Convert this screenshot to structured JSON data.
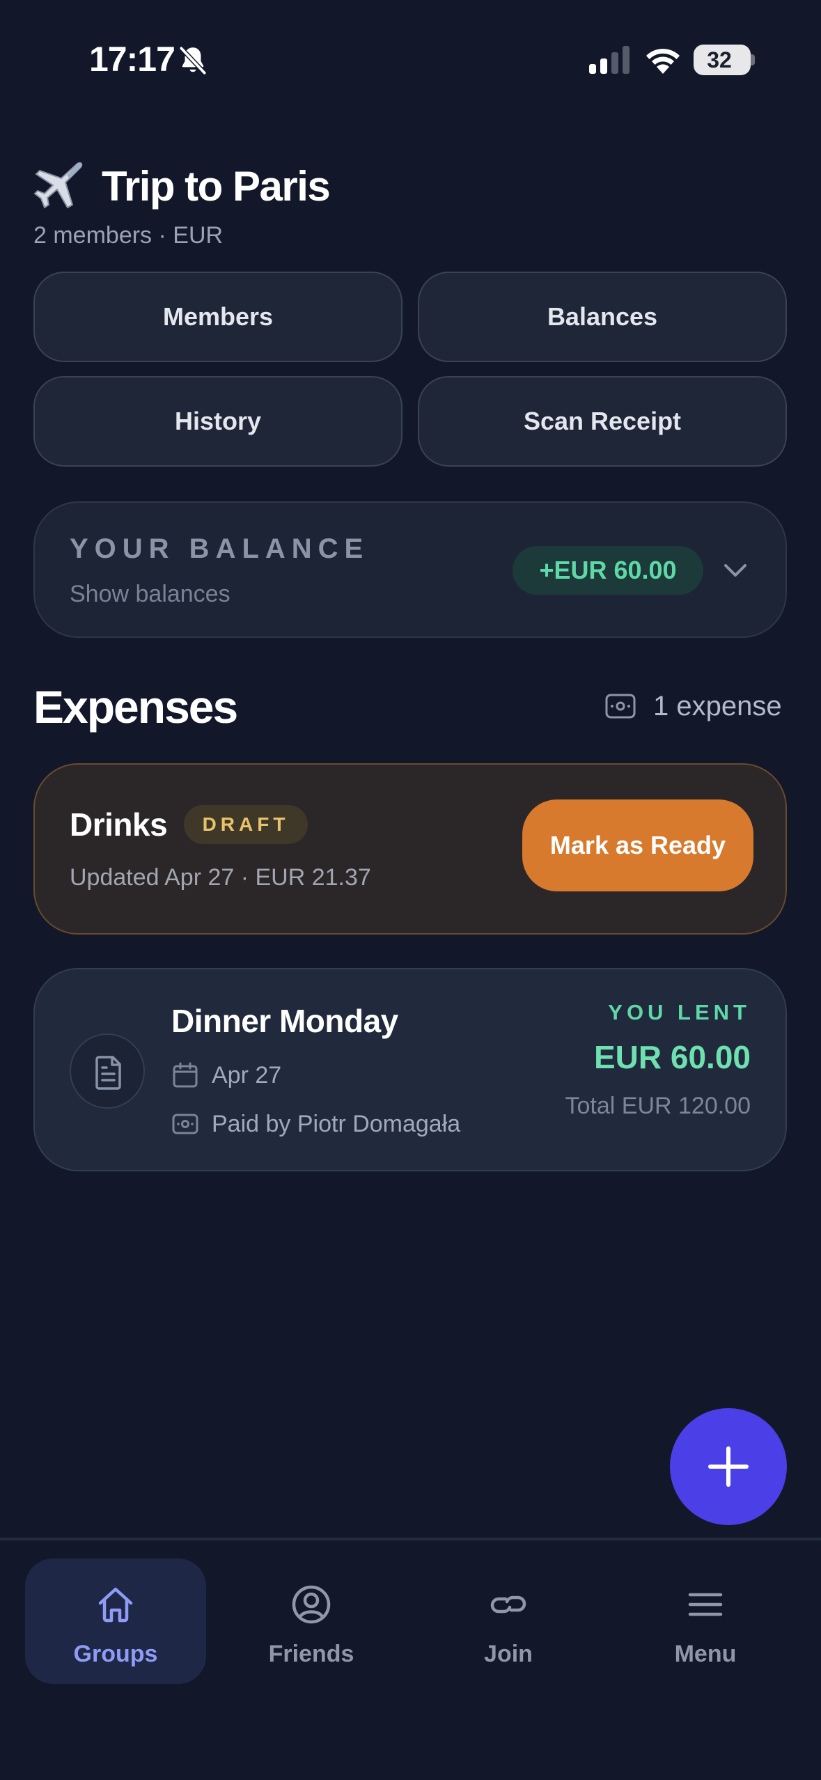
{
  "status_bar": {
    "time": "17:17",
    "battery": "32"
  },
  "group": {
    "emoji": "airplane-emoji",
    "title": "Trip to Paris",
    "subtitle": "2 members · EUR"
  },
  "actions": {
    "members": "Members",
    "balances": "Balances",
    "history": "History",
    "scan_receipt": "Scan Receipt"
  },
  "balance": {
    "label": "YOUR BALANCE",
    "sub": "Show balances",
    "amount": "+EUR 60.00"
  },
  "expenses": {
    "title": "Expenses",
    "count": "1 expense",
    "draft": {
      "name": "Drinks",
      "badge": "DRAFT",
      "meta": "Updated Apr 27 · EUR 21.37",
      "action": "Mark as Ready"
    },
    "items": [
      {
        "name": "Dinner Monday",
        "date": "Apr 27",
        "paid_by": "Paid by Piotr Domagała",
        "status": "YOU LENT",
        "amount": "EUR 60.00",
        "total": "Total EUR 120.00"
      }
    ]
  },
  "tabs": [
    {
      "label": "Groups",
      "icon": "home-icon",
      "active": true
    },
    {
      "label": "Friends",
      "icon": "person-icon",
      "active": false
    },
    {
      "label": "Join",
      "icon": "link-icon",
      "active": false
    },
    {
      "label": "Menu",
      "icon": "menu-icon",
      "active": false
    }
  ],
  "colors": {
    "background": "#121829",
    "accent": "#4b3fe8",
    "positive": "#5fd8a8",
    "draft": "#d77a2e"
  }
}
